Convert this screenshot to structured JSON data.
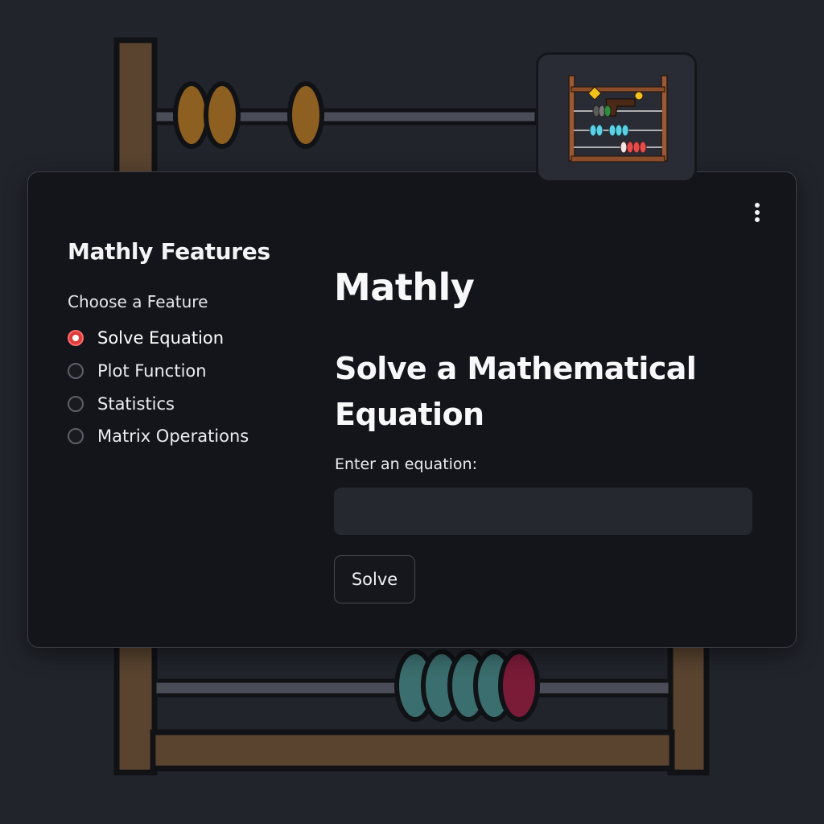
{
  "app": {
    "title": "Mathly"
  },
  "logo": {
    "icon": "abacus-logo-icon"
  },
  "menu": {
    "icon": "kebab-menu-icon"
  },
  "sidebar": {
    "title": "Mathly Features",
    "radio_group_label": "Choose a Feature",
    "selected_index": 0,
    "options": [
      {
        "label": "Solve Equation",
        "selected": true
      },
      {
        "label": "Plot Function",
        "selected": false
      },
      {
        "label": "Statistics",
        "selected": false
      },
      {
        "label": "Matrix Operations",
        "selected": false
      }
    ]
  },
  "main": {
    "section_heading_line1": "Solve a Mathematical",
    "section_heading_line2": "Equation",
    "input_label": "Enter an equation:",
    "input_value": "",
    "input_placeholder": "",
    "solve_button_label": "Solve"
  },
  "colors": {
    "background": "#22242c",
    "card": "#14151a",
    "accent_radio": "#e03b3b",
    "input_fill": "#262830",
    "abacus_wood": "#5a4430",
    "bead_amber": "#8d5f20",
    "bead_teal": "#3b6e6e",
    "bead_crimson": "#7a1b38"
  }
}
